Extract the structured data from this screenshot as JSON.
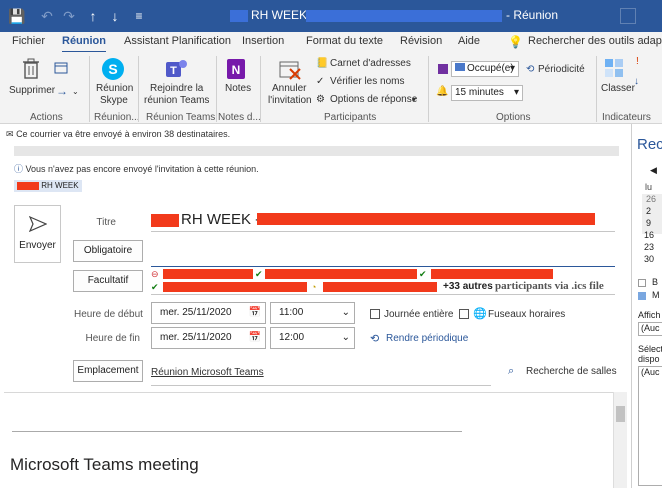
{
  "window": {
    "title_fragment": "RH WEEK -",
    "title_suffix": "- Réunion"
  },
  "qat": {
    "save_icon": "💾",
    "undo_icon": "↶",
    "redo_icon": "↷",
    "up_icon": "↑",
    "down_icon": "↓",
    "more_icon": "≡"
  },
  "tabs": [
    {
      "label": "Fichier"
    },
    {
      "label": "Réunion"
    },
    {
      "label": "Assistant Planification"
    },
    {
      "label": "Insertion"
    },
    {
      "label": "Format du texte"
    },
    {
      "label": "Révision"
    },
    {
      "label": "Aide"
    }
  ],
  "search": {
    "placeholder": "Rechercher des outils adaptés"
  },
  "ribbon": {
    "delete_label": "Supprimer",
    "actions_group": "Actions",
    "skype_label_1": "Réunion",
    "skype_label_2": "Skype",
    "skype_group": "Réunion...",
    "teams_label_1": "Rejoindre la",
    "teams_label_2": "réunion Teams",
    "teams_group": "Réunion Teams",
    "notes_label": "Notes",
    "notes_group": "Notes d...",
    "cancel_label_1": "Annuler",
    "cancel_label_2": "l'invitation",
    "address_book": "Carnet d'adresses",
    "check_names": "Vérifier les noms",
    "response_options": "Options de réponse",
    "participants_group": "Participants",
    "busy_status": "Occupé(e)",
    "reminder": "15 minutes",
    "recurrence": "Périodicité",
    "options_group": "Options",
    "categorize": "Classer",
    "indicators_group": "Indicateurs"
  },
  "info": {
    "sent_to": "Ce courrier va être envoyé à environ 38 destinataires.",
    "not_sent": "Vous n'avez pas encore envoyé l'invitation à cette réunion.",
    "tag": "RH WEEK"
  },
  "form": {
    "send_label": "Envoyer",
    "title_label": "Titre",
    "title_value": "RH WEEK - E",
    "required_btn": "Obligatoire",
    "optional_btn": "Facultatif",
    "more_participants": "+33 autres",
    "participants_note": "participants via .ics file",
    "start_label": "Heure de début",
    "end_label": "Heure de fin",
    "start_date": "mer. 25/11/2020",
    "start_time": "11:00",
    "end_date": "mer. 25/11/2020",
    "end_time": "12:00",
    "all_day": "Journée entière",
    "time_zones": "Fuseaux horaires",
    "make_recurring": "Rendre périodique",
    "location_btn": "Emplacement",
    "location_value": "Réunion Microsoft Teams",
    "room_finder": "Recherche de salles"
  },
  "body": {
    "heading": "Microsoft Teams meeting"
  },
  "right_pane": {
    "title": "Rec",
    "weekday": "lu",
    "days": [
      "26",
      "2",
      "9",
      "16",
      "23",
      "30"
    ],
    "legend_b": "B",
    "legend_m": "M",
    "show_label": "Affich",
    "show_value": "(Auc",
    "select_label": "Sélect",
    "avail_label": "dispo",
    "avail_value": "(Auc"
  },
  "colors": {
    "accent": "#2b579a",
    "redaction": "#f23a1b"
  }
}
